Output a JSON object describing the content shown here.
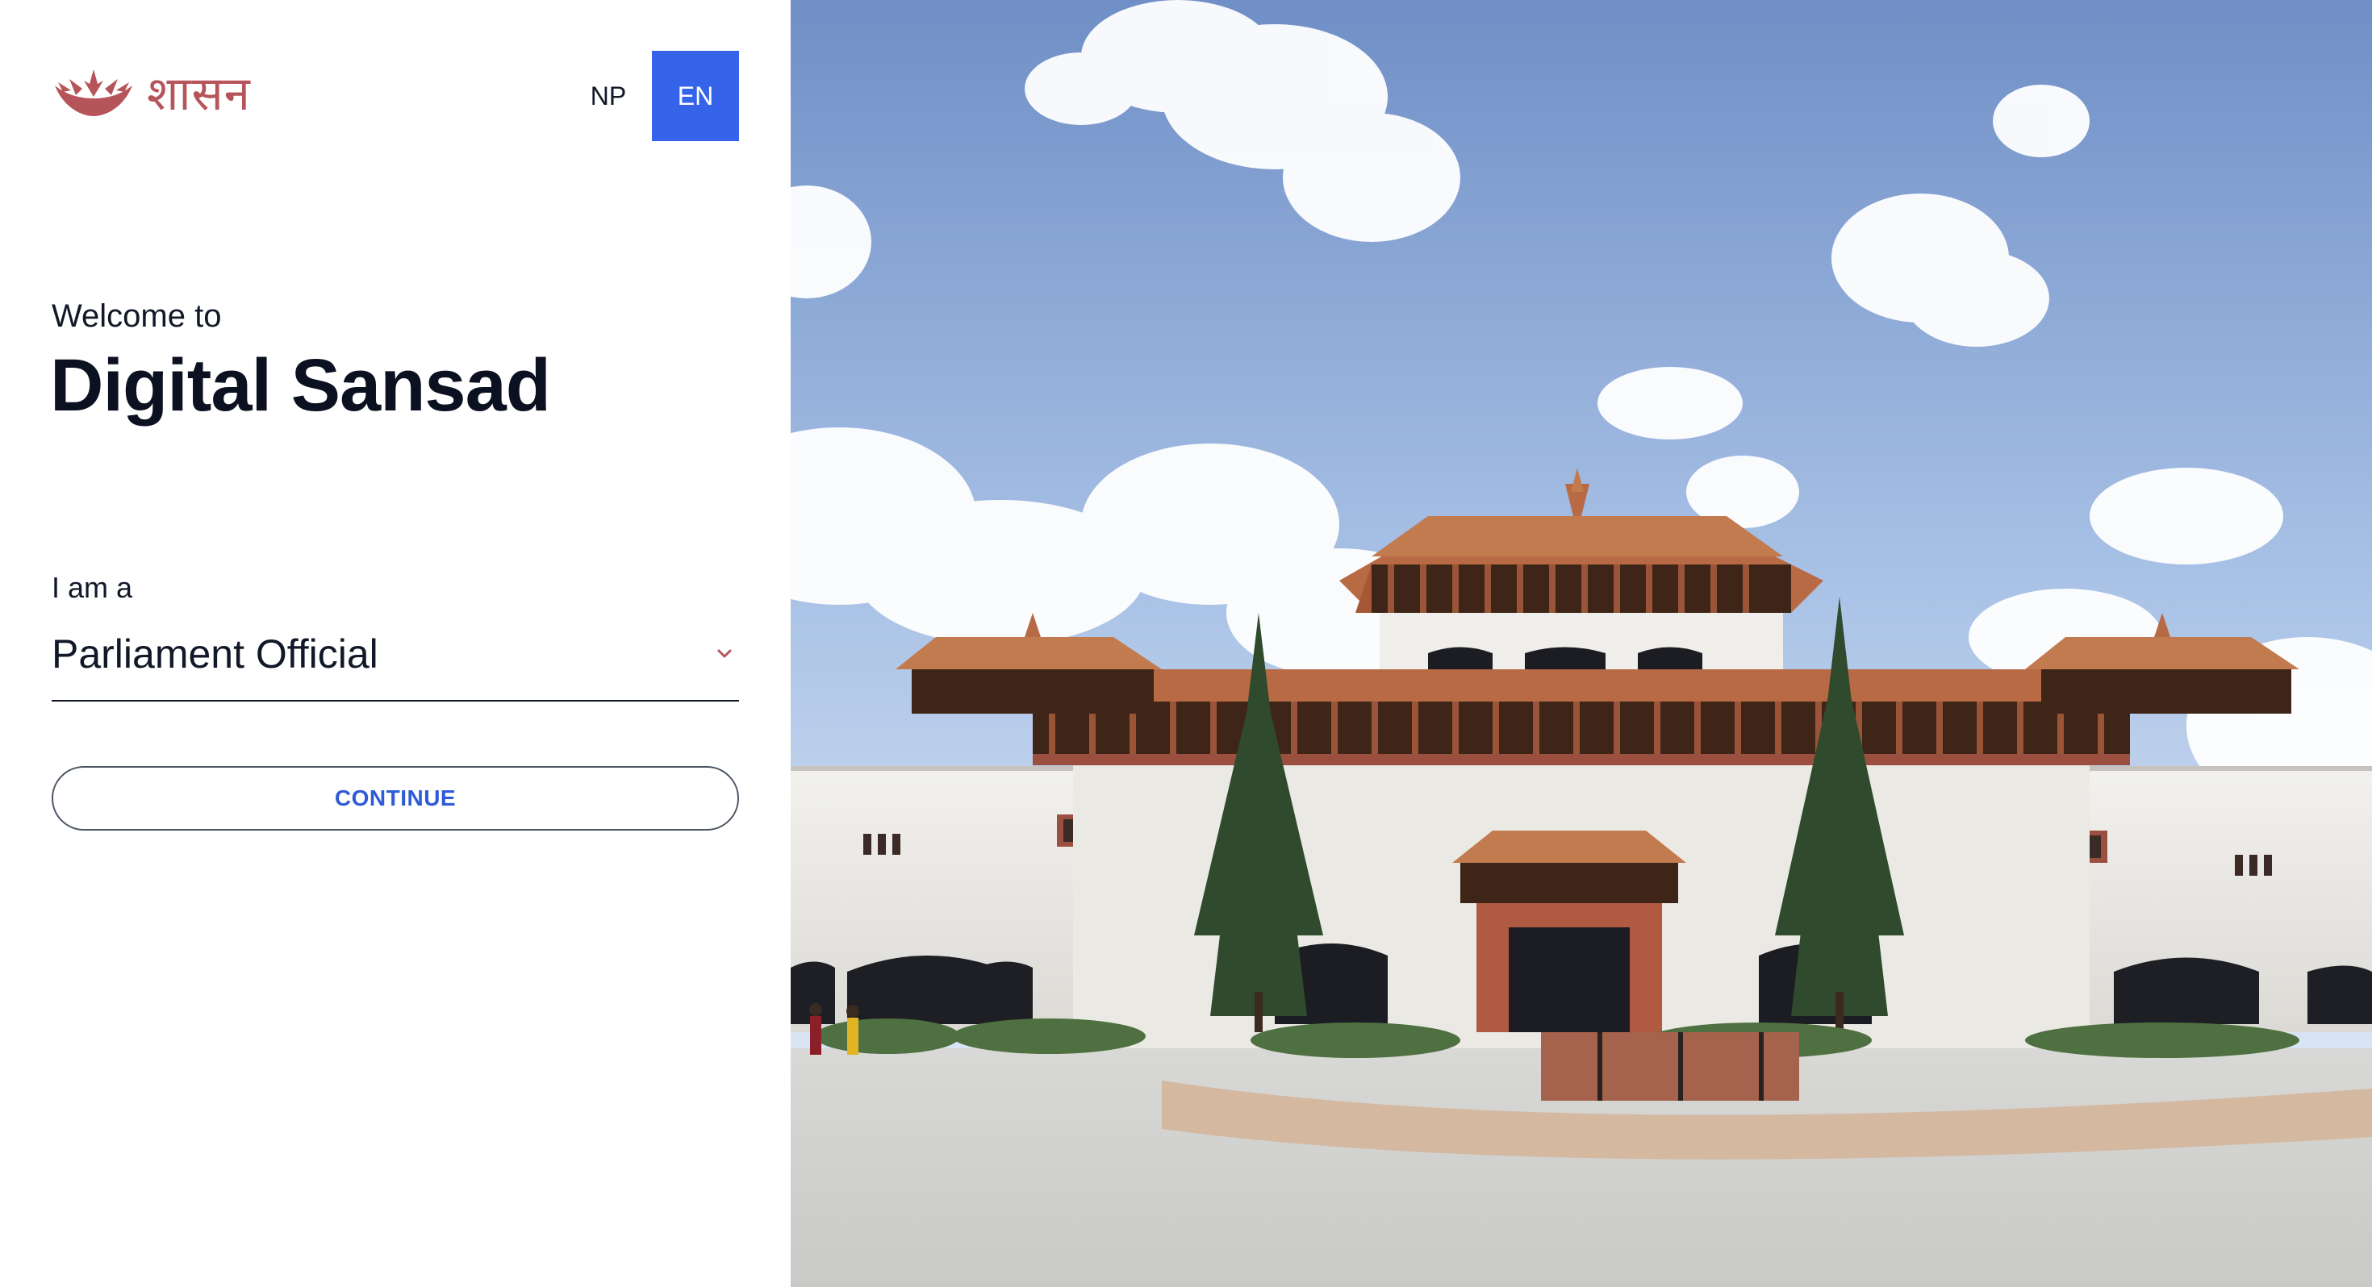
{
  "brand": {
    "logo_text": "शासन",
    "emblem_icon": "lotus-icon",
    "color": "#b5555a"
  },
  "language": {
    "options": [
      "NP",
      "EN"
    ],
    "selected": "EN",
    "active_color": "#3563e9"
  },
  "welcome": {
    "intro": "Welcome to",
    "title": "Digital Sansad"
  },
  "form": {
    "role_label": "I am a",
    "role_value": "Parliament Official",
    "dropdown_icon": "chevron-down-icon",
    "continue_label": "CONTINUE",
    "continue_color": "#2f5bd8"
  },
  "hero": {
    "image": "parliament-building-photo"
  }
}
